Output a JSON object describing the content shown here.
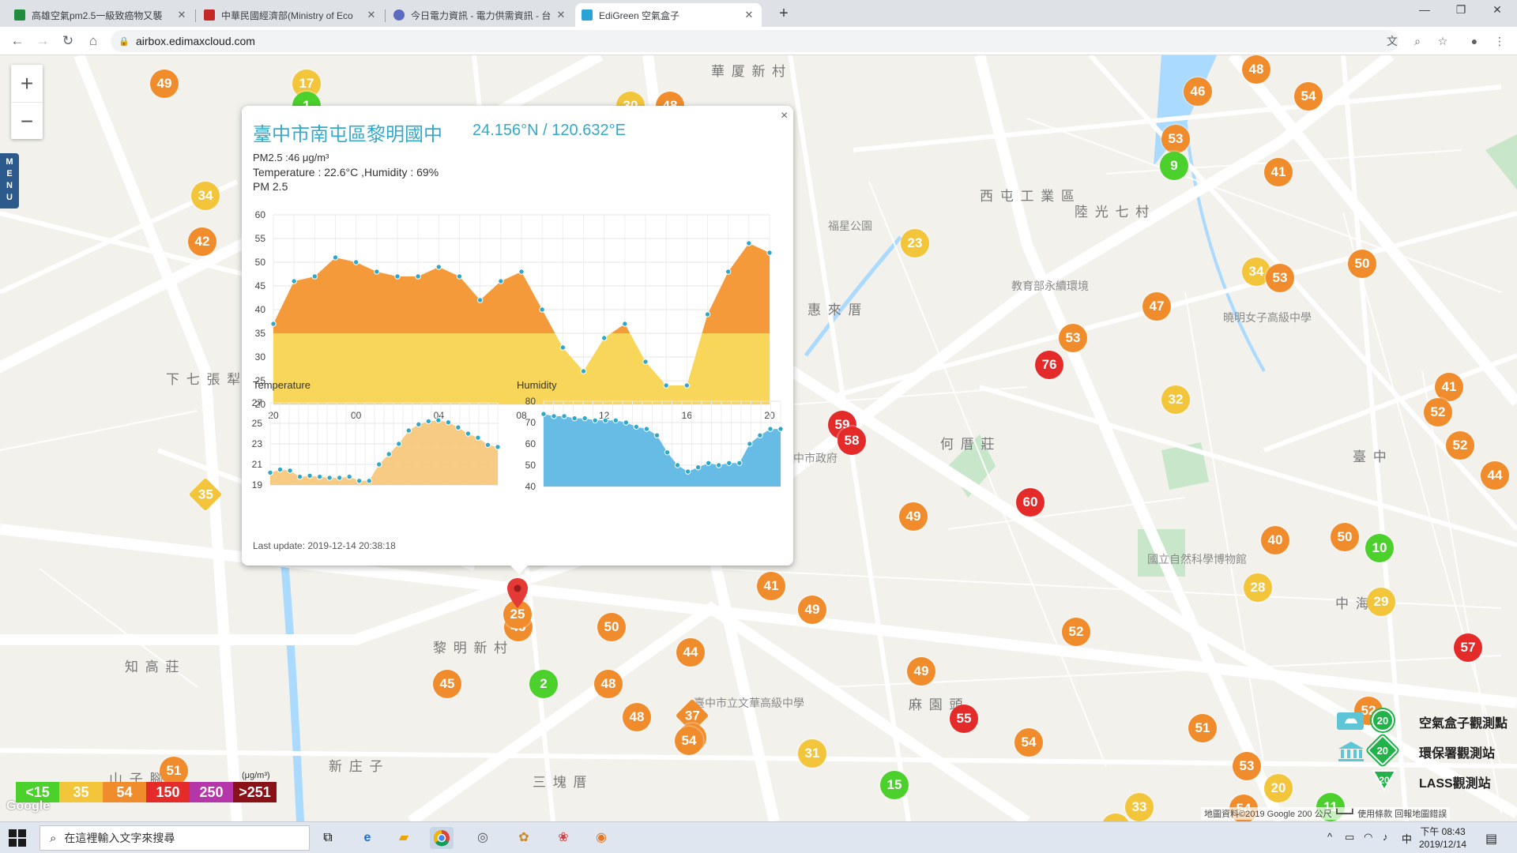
{
  "browser": {
    "tabs": [
      {
        "title": "高雄空氣pm2.5一級致癌物又襲",
        "fav": "#1e8e3e",
        "active": false
      },
      {
        "title": "中華民國經濟部(Ministry of Eco",
        "fav": "#c62828",
        "active": false
      },
      {
        "title": "今日電力資訊 - 電力供需資訊 - 台",
        "fav": "#5c6bc0",
        "active": false
      },
      {
        "title": "EdiGreen 空氣盒子",
        "fav": "#29a3d6",
        "active": true
      }
    ],
    "url": "airbox.edimaxcloud.com"
  },
  "map": {
    "labels": [
      {
        "text": "華 厦 新 村",
        "big": true
      },
      {
        "text": "西 屯 工 業 區",
        "big": true
      },
      {
        "text": "陸 光 七 村",
        "big": true
      },
      {
        "text": "福星公園",
        "big": false
      },
      {
        "text": "惠 來 厝",
        "big": true
      },
      {
        "text": "何 厝 莊",
        "big": true
      },
      {
        "text": "下 七 張 犁",
        "big": true
      },
      {
        "text": "黎 明 新 村",
        "big": true
      },
      {
        "text": "知 高 莊",
        "big": true
      },
      {
        "text": "新 庄 子",
        "big": true
      },
      {
        "text": "三 塊 厝",
        "big": true
      },
      {
        "text": "麻 園 頭",
        "big": true
      },
      {
        "text": "臺 中",
        "big": true
      },
      {
        "text": "中 海",
        "big": true
      },
      {
        "text": "山 子 腳",
        "big": true
      },
      {
        "text": "國立自然科學博物館",
        "big": false
      },
      {
        "text": "教育部永續環境",
        "big": false
      },
      {
        "text": "中市政府",
        "big": false
      },
      {
        "text": "臺中市立文華高級中學",
        "big": false
      },
      {
        "text": "曉明女子高級中學",
        "big": false
      }
    ],
    "markers": [
      {
        "v": "49",
        "c": "#f08c2c"
      },
      {
        "v": "17",
        "c": "#f2c53a"
      },
      {
        "v": "1",
        "c": "#4cd02c"
      },
      {
        "v": "30",
        "c": "#f2c53a"
      },
      {
        "v": "48",
        "c": "#f08c2c"
      },
      {
        "v": "34",
        "c": "#f2c53a"
      },
      {
        "v": "42",
        "c": "#f08c2c"
      },
      {
        "v": "35",
        "c": "#f2c53a",
        "diamond": true
      },
      {
        "v": "48",
        "c": "#f08c2c"
      },
      {
        "v": "54",
        "c": "#f08c2c"
      },
      {
        "v": "46",
        "c": "#f08c2c"
      },
      {
        "v": "53",
        "c": "#f08c2c"
      },
      {
        "v": "9",
        "c": "#4cd02c"
      },
      {
        "v": "41",
        "c": "#f08c2c"
      },
      {
        "v": "23",
        "c": "#f2c53a"
      },
      {
        "v": "34",
        "c": "#f2c53a"
      },
      {
        "v": "53",
        "c": "#f08c2c"
      },
      {
        "v": "50",
        "c": "#f08c2c"
      },
      {
        "v": "47",
        "c": "#f08c2c"
      },
      {
        "v": "76",
        "c": "#e52a2a"
      },
      {
        "v": "53",
        "c": "#f08c2c"
      },
      {
        "v": "32",
        "c": "#f2c53a"
      },
      {
        "v": "41",
        "c": "#f08c2c"
      },
      {
        "v": "52",
        "c": "#f08c2c"
      },
      {
        "v": "52",
        "c": "#f08c2c"
      },
      {
        "v": "44",
        "c": "#f08c2c"
      },
      {
        "v": "59",
        "c": "#e52a2a"
      },
      {
        "v": "58",
        "c": "#e52a2a"
      },
      {
        "v": "60",
        "c": "#e52a2a"
      },
      {
        "v": "49",
        "c": "#f08c2c"
      },
      {
        "v": "40",
        "c": "#f08c2c"
      },
      {
        "v": "50",
        "c": "#f08c2c"
      },
      {
        "v": "10",
        "c": "#4cd02c"
      },
      {
        "v": "28",
        "c": "#f2c53a"
      },
      {
        "v": "29",
        "c": "#f2c53a"
      },
      {
        "v": "41",
        "c": "#f08c2c"
      },
      {
        "v": "49",
        "c": "#f08c2c"
      },
      {
        "v": "52",
        "c": "#f08c2c"
      },
      {
        "v": "57",
        "c": "#e52a2a"
      },
      {
        "v": "46",
        "c": "#f08c2c"
      },
      {
        "v": "50",
        "c": "#f08c2c"
      },
      {
        "v": "44",
        "c": "#f08c2c"
      },
      {
        "v": "49",
        "c": "#f08c2c"
      },
      {
        "v": "45",
        "c": "#f08c2c"
      },
      {
        "v": "2",
        "c": "#4cd02c"
      },
      {
        "v": "48",
        "c": "#f08c2c"
      },
      {
        "v": "48",
        "c": "#f08c2c"
      },
      {
        "v": "37",
        "c": "#f08c2c",
        "diamond": true
      },
      {
        "v": "9",
        "c": "#f08c2c"
      },
      {
        "v": "54",
        "c": "#f08c2c"
      },
      {
        "v": "31",
        "c": "#f2c53a"
      },
      {
        "v": "55",
        "c": "#e52a2a"
      },
      {
        "v": "54",
        "c": "#f08c2c"
      },
      {
        "v": "52",
        "c": "#f08c2c"
      },
      {
        "v": "51",
        "c": "#f08c2c"
      },
      {
        "v": "53",
        "c": "#f08c2c"
      },
      {
        "v": "20",
        "c": "#f2c53a"
      },
      {
        "v": "33",
        "c": "#f2c53a"
      },
      {
        "v": "54",
        "c": "#f08c2c"
      },
      {
        "v": "11",
        "c": "#4cd02c"
      },
      {
        "v": "15",
        "c": "#4cd02c"
      },
      {
        "v": "51",
        "c": "#f08c2c"
      },
      {
        "v": "32",
        "c": "#f2c53a"
      }
    ],
    "menu_label": "MENU"
  },
  "popup": {
    "title": "臺中市南屯區黎明國中",
    "coords": "24.156°N / 120.632°E",
    "pm25_text": "PM2.5 :46 μg/m³",
    "temp_humidity_text": "Temperature : 22.6°C ,Humidity : 69%",
    "pm_chart_label": "PM 2.5",
    "temp_chart_label": "Temperature",
    "hum_chart_label": "Humidity",
    "last_update": "Last update: 2019-12-14 20:38:18",
    "close_glyph": "×"
  },
  "chart_data": [
    {
      "type": "area",
      "title": "PM 2.5",
      "x_ticks": [
        "20",
        "00",
        "04",
        "08",
        "12",
        "16",
        "20"
      ],
      "y_ticks": [
        20,
        25,
        30,
        35,
        40,
        45,
        50,
        55,
        60
      ],
      "ylim": [
        20,
        60
      ],
      "values": [
        37,
        46,
        47,
        51,
        50,
        48,
        47,
        47,
        49,
        47,
        42,
        46,
        48,
        40,
        32,
        27,
        34,
        37,
        29,
        24,
        24,
        39,
        48,
        54,
        52
      ],
      "color_above": "#f59a3a",
      "color_below": "#f7d65a",
      "threshold": 35
    },
    {
      "type": "area",
      "title": "Temperature",
      "y_ticks": [
        19,
        21,
        23,
        25,
        27
      ],
      "ylim": [
        19,
        27
      ],
      "values": [
        20.2,
        20.5,
        20.4,
        19.8,
        19.9,
        19.8,
        19.7,
        19.7,
        19.8,
        19.4,
        19.4,
        21.0,
        22.0,
        23.0,
        24.3,
        24.9,
        25.2,
        25.3,
        25.1,
        24.6,
        24.0,
        23.6,
        22.9,
        22.7
      ],
      "color": "#f7c26e"
    },
    {
      "type": "area",
      "title": "Humidity",
      "y_ticks": [
        40,
        50,
        60,
        70,
        80
      ],
      "ylim": [
        40,
        80
      ],
      "values": [
        74,
        73,
        73,
        72,
        72,
        71,
        71,
        71,
        70,
        68,
        67,
        64,
        56,
        50,
        47,
        49,
        51,
        50,
        51,
        51,
        60,
        64,
        67,
        67
      ],
      "color": "#5eb8e3"
    }
  ],
  "aqi_legend": {
    "cells": [
      {
        "label": "<15",
        "c": "#4cd02c"
      },
      {
        "label": "35",
        "c": "#f2c53a"
      },
      {
        "label": "54",
        "c": "#f08c2c"
      },
      {
        "label": "150",
        "c": "#e52a2a"
      },
      {
        "label": "250",
        "c": "#b536a8"
      },
      {
        "label": ">251",
        "c": "#8a1118"
      }
    ],
    "unit": "(μg/m³)"
  },
  "google_logo": "Google",
  "station_legend": [
    {
      "count": "20",
      "label": "空氣盒子觀測點"
    },
    {
      "count": "20",
      "label": "環保署觀測站"
    },
    {
      "count": "20",
      "label": "LASS觀測站"
    }
  ],
  "attribution": "地圖資料©2019 Google  200 公尺 ┗━━┛  使用條款  回報地圖錯誤",
  "taskbar": {
    "search_placeholder": "在這裡輸入文字來搜尋",
    "time": "下午 08:43",
    "date": "2019/12/14",
    "ime": "中"
  }
}
